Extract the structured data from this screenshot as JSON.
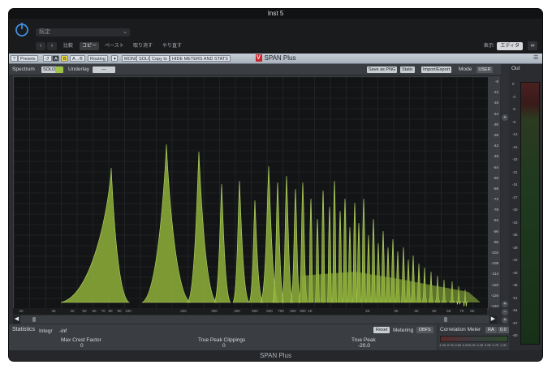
{
  "window": {
    "title": "Inst 5"
  },
  "host": {
    "preset_placeholder": "既定",
    "nav_back": "‹",
    "nav_forward": "›",
    "buttons": [
      {
        "label": "比較",
        "active": false
      },
      {
        "label": "コピー",
        "active": true
      },
      {
        "label": "ペースト",
        "active": false
      },
      {
        "label": "取り消す",
        "active": false
      },
      {
        "label": "やり直す",
        "active": false
      }
    ],
    "display_label": "表示:",
    "display_value": "エディタ"
  },
  "toolbar": {
    "help": "?",
    "presets": "Presets",
    "ab_a": "A",
    "ab_b": "B",
    "ab_copy": "A→B",
    "routing": "Routing",
    "mono": "MONO",
    "solo": "SOLO",
    "copy_to": "Copy to",
    "hide_meters": "HIDE METERS AND STATS",
    "brand": "SPAN Plus",
    "brand_logo": "V"
  },
  "spectrum": {
    "label": "Spectrum",
    "chip1": "SOLO",
    "chip2": "",
    "underlay": "Underlay",
    "underlay_value": "—",
    "save_png": "Save as PNG",
    "static": "Static",
    "import_export": "Import/Export",
    "mode": "Mode",
    "mode_value": "USER"
  },
  "db_scale": [
    "-6",
    "-12",
    "-18",
    "-24",
    "-30",
    "-36",
    "-42",
    "-48",
    "-54",
    "-60",
    "-66",
    "-72",
    "-78",
    "-84",
    "-90",
    "-96",
    "-102",
    "-108",
    "-114",
    "-120",
    "-126",
    "-132"
  ],
  "freq_labels": [
    "20",
    "30",
    "40",
    "50",
    "60",
    "70",
    "80",
    "90",
    "100",
    "200",
    "300",
    "400",
    "500",
    "600",
    "700",
    "800",
    "900",
    "1K",
    "2K",
    "3K",
    "4K",
    "5K",
    "6K",
    "7K",
    "8K"
  ],
  "output": {
    "label": "Out",
    "scale": [
      "0",
      "-3",
      "-6",
      "-9",
      "-12",
      "-15",
      "-18",
      "-21",
      "-24",
      "-27",
      "-30",
      "-33",
      "-36",
      "-39",
      "-42",
      "-45",
      "-48",
      "-51",
      "-54",
      "-57",
      "-60"
    ]
  },
  "statistics": {
    "label": "Statistics",
    "integr_label": "Integr",
    "integr_value": "-inf",
    "max_crest_label": "Max Crest Factor",
    "max_crest_value": "0",
    "tpc_label": "True Peak Clippings",
    "tpc_value": "0",
    "true_peak_label": "True Peak",
    "true_peak_value": "-20.0",
    "reset": "Reset",
    "metering": "Metering",
    "metering_value": "DBFS"
  },
  "correlation": {
    "label": "Correlation Meter",
    "btn1": "RA",
    "btn2": "0.0",
    "scale": [
      "-1.00",
      "-0.75",
      "-0.50",
      "-0.25",
      "0.00",
      "0.25",
      "0.50",
      "0.75",
      "1.00"
    ]
  },
  "footer": {
    "label": "SPAN Plus"
  },
  "colors": {
    "spectrum": "#8fb03a",
    "accent": "#e8d44a",
    "brand": "#c8262d"
  }
}
